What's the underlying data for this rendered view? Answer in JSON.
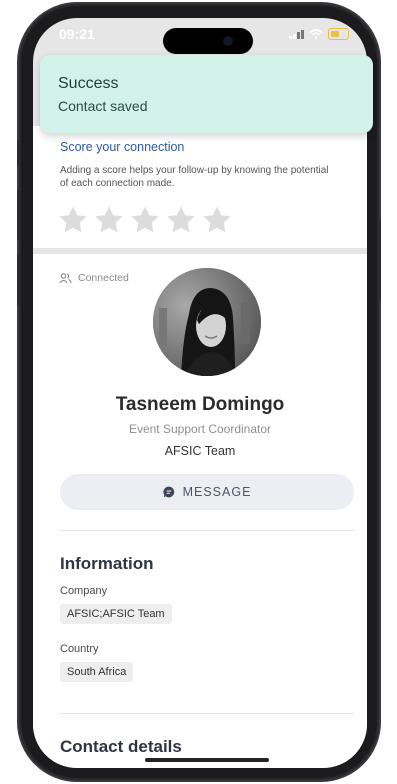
{
  "status_bar": {
    "time": "09:21"
  },
  "toast": {
    "title": "Success",
    "message": "Contact saved"
  },
  "rating": {
    "title": "Score your connection",
    "description": "Adding a score helps your follow-up by knowing the potential of each connection made.",
    "stars_total": 5,
    "stars_selected": 0
  },
  "contact": {
    "status": "Connected",
    "name": "Tasneem Domingo",
    "role": "Event Support Coordinator",
    "team": "AFSIC Team",
    "message_button": "MESSAGE"
  },
  "information": {
    "title": "Information",
    "company_label": "Company",
    "company_value": "AFSIC;AFSIC Team",
    "country_label": "Country",
    "country_value": "South Africa"
  },
  "contact_details": {
    "title": "Contact details"
  },
  "colors": {
    "toast_bg": "#d3f2ea",
    "link_blue": "#2e5aa8",
    "star_gray": "#dcdcdc"
  }
}
